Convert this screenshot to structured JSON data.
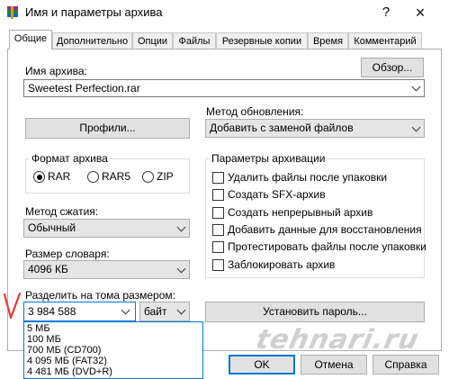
{
  "window": {
    "title": "Имя и параметры архива",
    "help_label": "?",
    "close_label": "×"
  },
  "tabs": [
    "Общие",
    "Дополнительно",
    "Опции",
    "Файлы",
    "Резервные копии",
    "Время",
    "Комментарий"
  ],
  "archive_name": {
    "label": "Имя архива:",
    "value": "Sweetest Perfection.rar",
    "browse_label": "Обзор..."
  },
  "profiles_label": "Профили...",
  "update_method": {
    "label": "Метод обновления:",
    "value": "Добавить с заменой файлов"
  },
  "format": {
    "title": "Формат архива",
    "options": [
      "RAR",
      "RAR5",
      "ZIP"
    ],
    "selected": "RAR"
  },
  "options": {
    "title": "Параметры архивации",
    "items": [
      "Удалить файлы после упаковки",
      "Создать SFX-архив",
      "Создать непрерывный архив",
      "Добавить данные для восстановления",
      "Протестировать файлы после упаковки",
      "Заблокировать архив"
    ]
  },
  "compression": {
    "label": "Метод сжатия:",
    "value": "Обычный"
  },
  "dictionary": {
    "label": "Размер словаря:",
    "value": "4096 КБ"
  },
  "split": {
    "label": "Разделить на тома размером:",
    "value": "3 984 588",
    "unit": "байт",
    "list": [
      "5 МБ",
      "100 МБ",
      "700 МБ   (CD700)",
      "4 095 МБ   (FAT32)",
      "4 481 МБ   (DVD+R)"
    ]
  },
  "password_label": "Установить пароль...",
  "buttons": {
    "ok": "OK",
    "cancel": "Отмена",
    "help": "Справка"
  },
  "watermark": "tehnari.ru",
  "colors": {
    "accent": "#0078d7",
    "red_mark": "#e53935"
  }
}
